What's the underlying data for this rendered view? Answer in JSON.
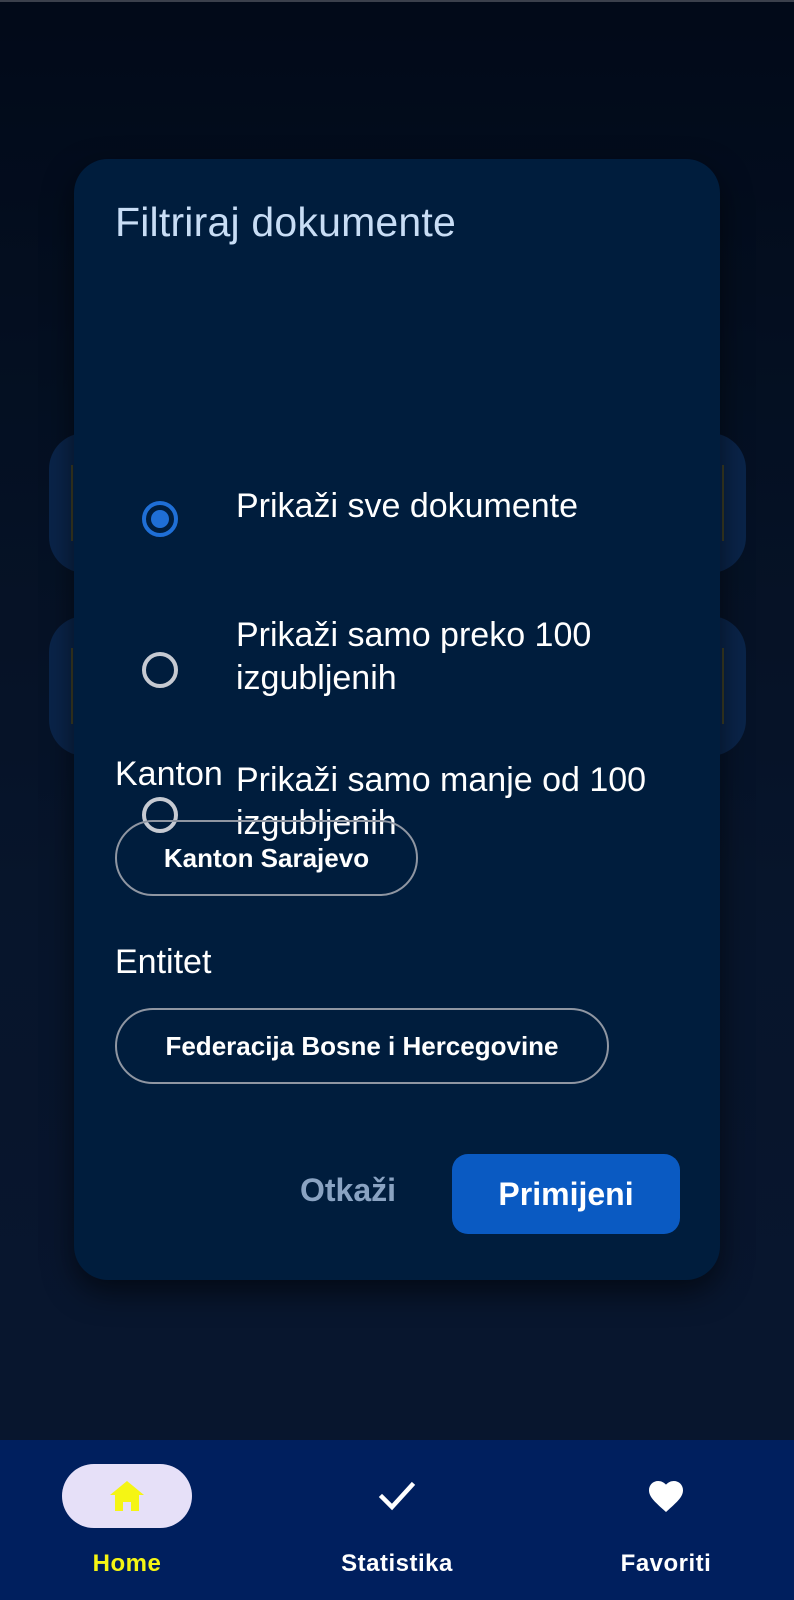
{
  "dialog": {
    "title": "Filtriraj dokumente",
    "options": [
      {
        "label": "Prikaži sve dokumente",
        "selected": true
      },
      {
        "label": "Prikaži samo preko 100 izgubljenih",
        "selected": false
      },
      {
        "label": "Prikaži samo manje od 100 izgubljenih",
        "selected": false
      }
    ],
    "kanton": {
      "label": "Kanton",
      "value": "Kanton Sarajevo"
    },
    "entitet": {
      "label": "Entitet",
      "value": "Federacija Bosne i Hercegovine"
    },
    "cancel_label": "Otkaži",
    "apply_label": "Primijeni"
  },
  "bottom_nav": {
    "items": [
      {
        "label": "Home",
        "icon": "home-icon",
        "active": true
      },
      {
        "label": "Statistika",
        "icon": "check-icon",
        "active": false
      },
      {
        "label": "Favoriti",
        "icon": "heart-icon",
        "active": false
      }
    ]
  },
  "colors": {
    "dialog_bg": "#001d3d",
    "accent": "#0a5ac2",
    "radio_selected": "#1f6fd6",
    "nav_bg": "#001f5e",
    "nav_active_label": "#f5f514",
    "nav_active_pill": "#e6e0f8"
  }
}
